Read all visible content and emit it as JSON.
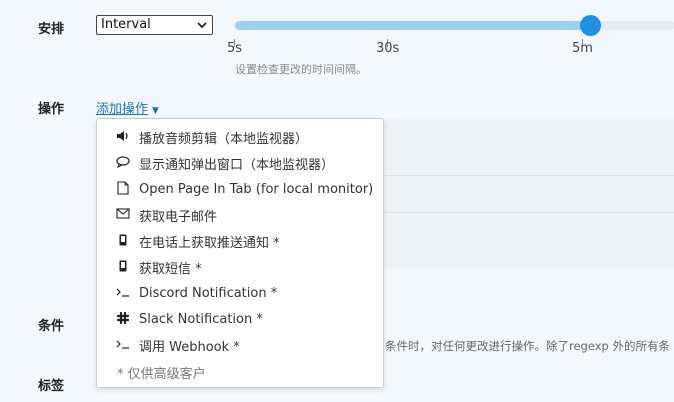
{
  "schedule": {
    "label": "安排",
    "mode": "Interval",
    "ticks": [
      "5s",
      "30s",
      "5m"
    ],
    "hint": "设置检查更改的时间间隔。"
  },
  "actions": {
    "label": "操作",
    "add_label": "添加操作",
    "menu": [
      {
        "icon": "speaker-icon",
        "label": "播放音频剪辑（本地监视器）"
      },
      {
        "icon": "speech-bubble-icon",
        "label": "显示通知弹出窗口（本地监视器）"
      },
      {
        "icon": "page-icon",
        "label": "Open Page In Tab (for local monitor)"
      },
      {
        "icon": "envelope-icon",
        "label": "获取电子邮件"
      },
      {
        "icon": "phone-icon",
        "label": "在电话上获取推送通知 *"
      },
      {
        "icon": "phone-icon",
        "label": "获取短信 *"
      },
      {
        "icon": "terminal-icon",
        "label": "Discord Notification *"
      },
      {
        "icon": "slack-icon",
        "label": "Slack Notification *"
      },
      {
        "icon": "terminal-icon",
        "label": "调用 Webhook *"
      }
    ],
    "footnote": "* 仅供高级客户"
  },
  "conditions": {
    "label": "条件",
    "text": "条件时，对任何更改进行操作。除了regexp 外的所有条"
  },
  "tags": {
    "label": "标签"
  }
}
